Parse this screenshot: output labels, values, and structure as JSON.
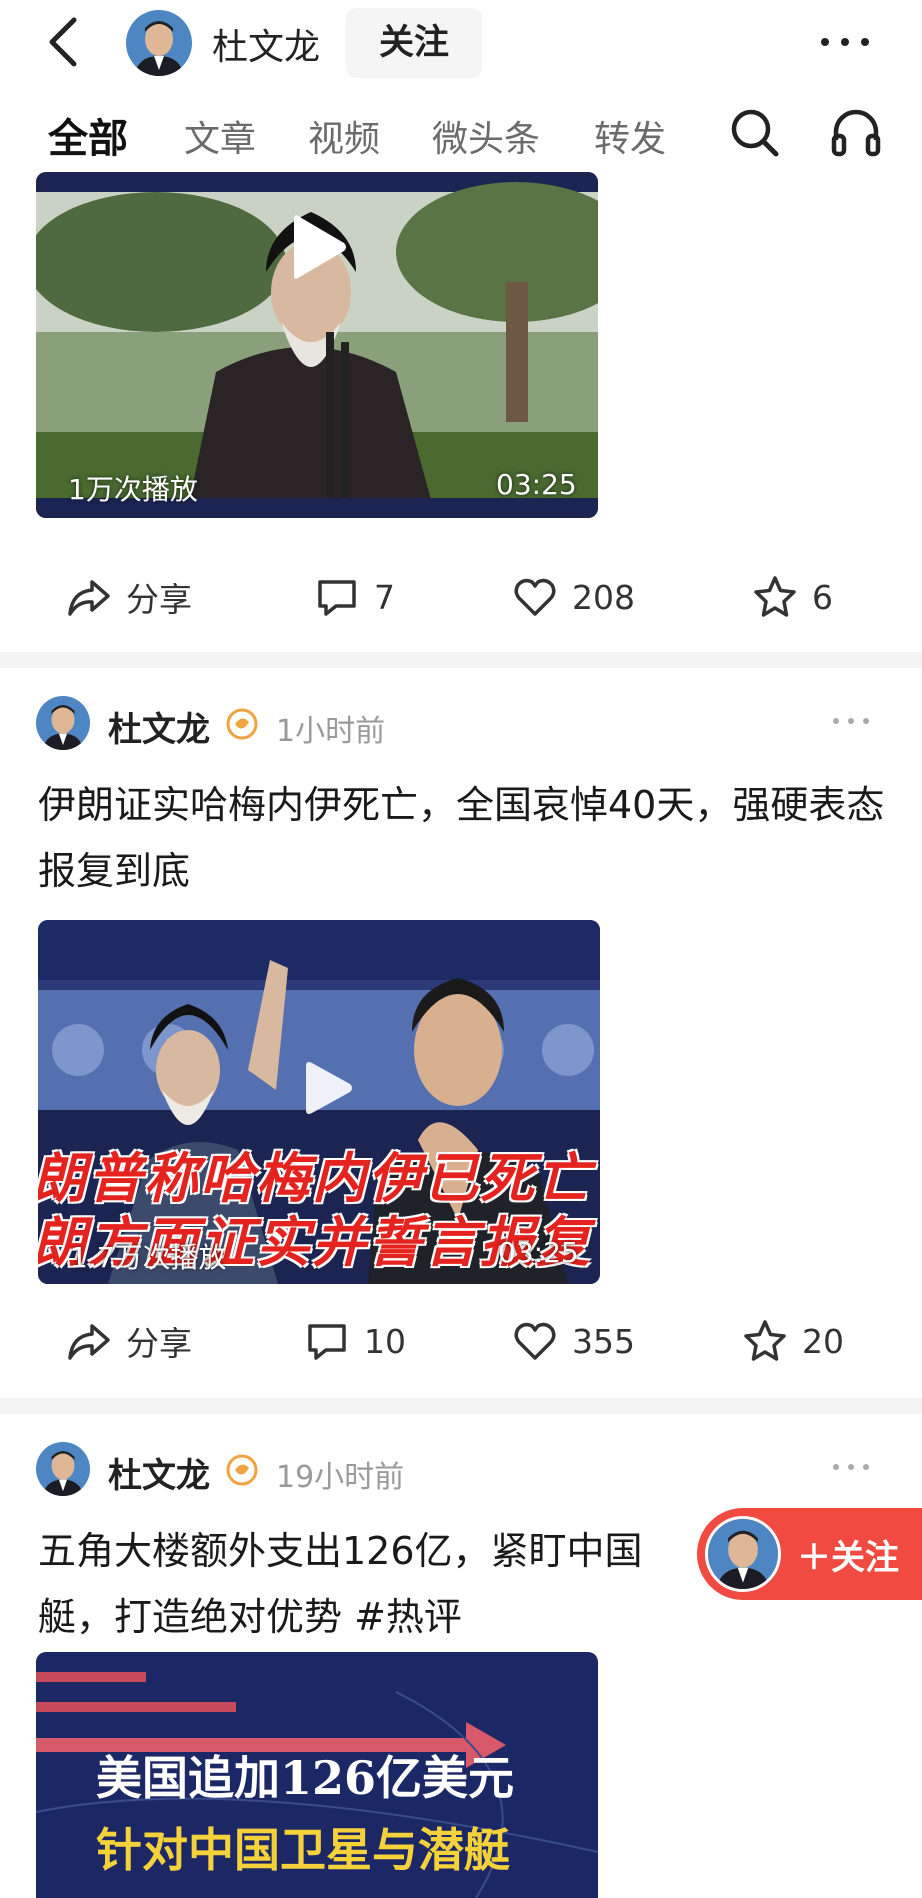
{
  "header": {
    "name": "杜文龙",
    "follow_label": "关注"
  },
  "tabs": [
    {
      "label": "全部"
    },
    {
      "label": "文章"
    },
    {
      "label": "视频"
    },
    {
      "label": "微头条"
    },
    {
      "label": "转发"
    }
  ],
  "posts": [
    {
      "video": {
        "plays": "1万次播放",
        "duration": "03:25"
      },
      "actions": {
        "share": "分享",
        "comments": "7",
        "likes": "208",
        "favorites": "6"
      }
    },
    {
      "author": "杜文龙",
      "time": "1小时前",
      "title": "伊朗证实哈梅内伊死亡，全国哀悼40天，强硬表态报复到底",
      "video": {
        "banner_line1": "朗普称哈梅内伊已死亡",
        "banner_line2": "朗方面证实并誓言报复",
        "plays": "1.7万次播放",
        "duration": "03:25"
      },
      "actions": {
        "share": "分享",
        "comments": "10",
        "likes": "355",
        "favorites": "20"
      }
    },
    {
      "author": "杜文龙",
      "time": "19小时前",
      "title": "五角大楼额外支出126亿，紧盯中国卫星与潜艇，打造绝对优势 #热评",
      "title_visible": "五角大楼额外支出126亿，紧盯中国",
      "title_line2": "艇，打造绝对优势 #热评",
      "image": {
        "line1": "美国追加126亿美元",
        "line2": "针对中国卫星与潜艇"
      }
    }
  ],
  "float_follow": {
    "label": "＋关注"
  },
  "colors": {
    "accent_red": "#f04a41",
    "text_primary": "#1a1a1a",
    "text_secondary": "#9a9a9a",
    "separator": "#f4f4f4",
    "verified_gold": "#f0a340"
  },
  "icons": [
    "back-arrow-icon",
    "more-icon",
    "search-icon",
    "headphones-icon",
    "share-icon",
    "comment-icon",
    "heart-icon",
    "star-icon",
    "verified-icon",
    "play-icon"
  ]
}
